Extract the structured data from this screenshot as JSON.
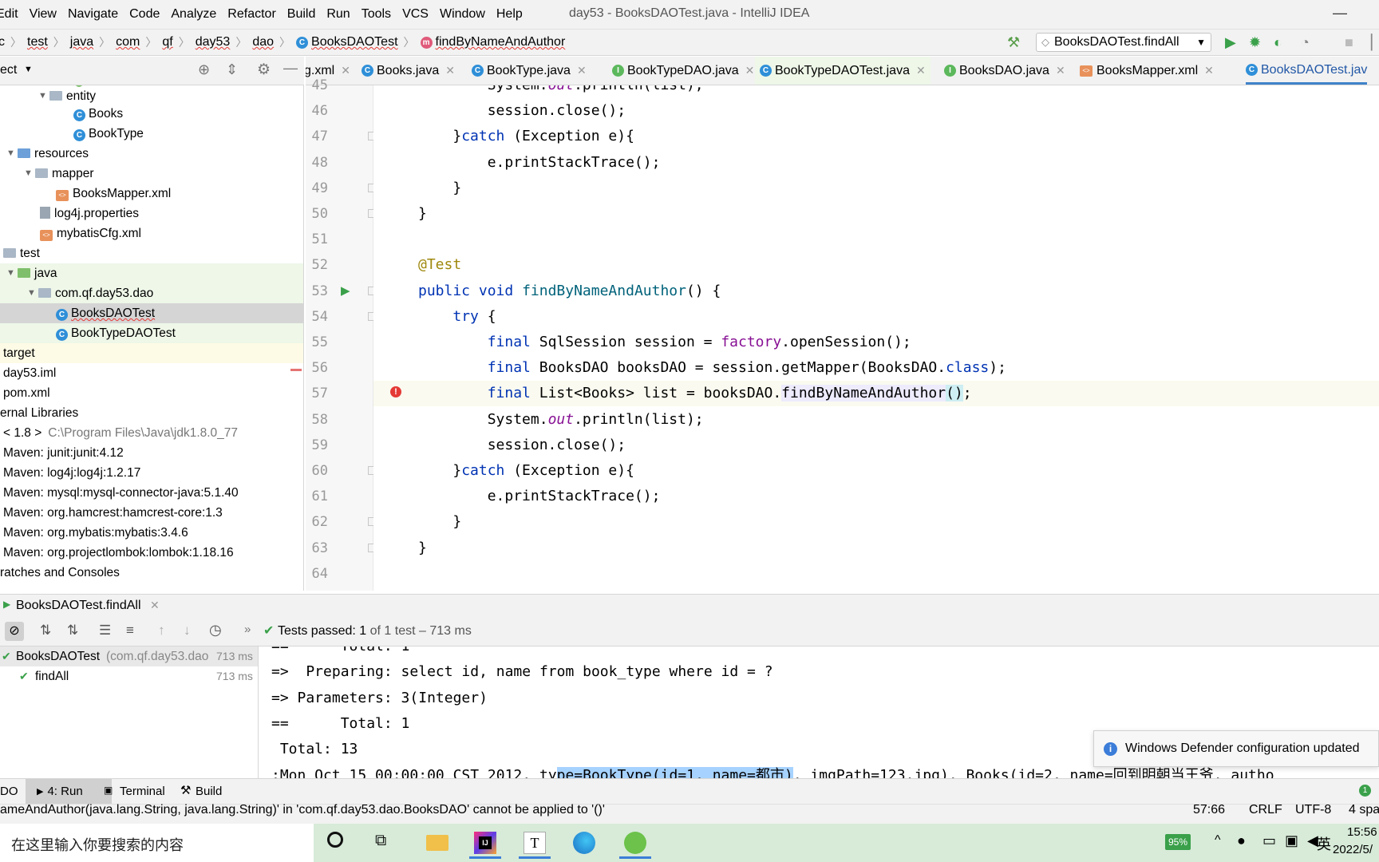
{
  "menu": {
    "items": [
      "Edit",
      "View",
      "Navigate",
      "Code",
      "Analyze",
      "Refactor",
      "Build",
      "Run",
      "Tools",
      "VCS",
      "Window",
      "Help"
    ],
    "window_title": "day53 - BooksDAOTest.java - IntelliJ IDEA",
    "minimize": "—"
  },
  "nav": {
    "crumbs": [
      "c",
      "test",
      "java",
      "com",
      "qf",
      "day53",
      "dao",
      "BooksDAOTest",
      "findByNameAndAuthor"
    ],
    "run_config": "BooksDAOTest.findAll"
  },
  "project": {
    "header": "ect",
    "rows": [
      {
        "label": "entity",
        "indent": 62,
        "type": "pkg",
        "arrow": true
      },
      {
        "label": "Books",
        "indent": 92,
        "type": "class"
      },
      {
        "label": "BookType",
        "indent": 92,
        "type": "class"
      },
      {
        "label": "resources",
        "indent": 22,
        "type": "res",
        "arrow": true
      },
      {
        "label": "mapper",
        "indent": 44,
        "type": "folder",
        "arrow": true
      },
      {
        "label": "BooksMapper.xml",
        "indent": 70,
        "type": "xml"
      },
      {
        "label": "log4j.properties",
        "indent": 50,
        "type": "props"
      },
      {
        "label": "mybatisCfg.xml",
        "indent": 50,
        "type": "xml"
      },
      {
        "label": "test",
        "indent": 4,
        "type": "folder"
      },
      {
        "label": "java",
        "indent": 22,
        "type": "green",
        "arrow": true
      },
      {
        "label": "com.qf.day53.dao",
        "indent": 48,
        "type": "pkg",
        "arrow": true
      },
      {
        "label": "BooksDAOTest",
        "indent": 70,
        "type": "class",
        "selected": true
      },
      {
        "label": "BookTypeDAOTest",
        "indent": 70,
        "type": "class"
      },
      {
        "label": "target",
        "indent": 4,
        "type": "plain"
      },
      {
        "label": "day53.iml",
        "indent": 4,
        "type": "plain"
      },
      {
        "label": "pom.xml",
        "indent": 4,
        "type": "plain"
      },
      {
        "label": "ernal Libraries",
        "indent": 0,
        "type": "plain"
      },
      {
        "label": "< 1.8 >",
        "indent": 4,
        "type": "plain",
        "suffix": "C:\\Program Files\\Java\\jdk1.8.0_77"
      },
      {
        "label": "Maven: junit:junit:4.12",
        "indent": 4,
        "type": "plain"
      },
      {
        "label": "Maven: log4j:log4j:1.2.17",
        "indent": 4,
        "type": "plain"
      },
      {
        "label": "Maven: mysql:mysql-connector-java:5.1.40",
        "indent": 4,
        "type": "plain"
      },
      {
        "label": "Maven: org.hamcrest:hamcrest-core:1.3",
        "indent": 4,
        "type": "plain"
      },
      {
        "label": "Maven: org.mybatis:mybatis:3.4.6",
        "indent": 4,
        "type": "plain"
      },
      {
        "label": "Maven: org.projectlombok:lombok:1.18.16",
        "indent": 4,
        "type": "plain"
      },
      {
        "label": "ratches and Consoles",
        "indent": 0,
        "type": "plain"
      }
    ]
  },
  "tabs": [
    {
      "label": "g.xml",
      "icon": "xml"
    },
    {
      "label": "Books.java",
      "icon": "c"
    },
    {
      "label": "BookType.java",
      "icon": "c"
    },
    {
      "label": "BookTypeDAO.java",
      "icon": "i"
    },
    {
      "label": "BookTypeDAOTest.java",
      "icon": "c"
    },
    {
      "label": "BooksDAO.java",
      "icon": "i"
    },
    {
      "label": "BooksMapper.xml",
      "icon": "xml"
    },
    {
      "label": "BooksDAOTest.jav",
      "icon": "c",
      "active": true
    }
  ],
  "code": {
    "lines": [
      {
        "n": "45",
        "html": "        System.<span class=\"it\">out</span>.println(list);"
      },
      {
        "n": "46",
        "html": "        session.close();"
      },
      {
        "n": "47",
        "html": "    }<span class=\"kw\">catch</span> (Exception e){"
      },
      {
        "n": "48",
        "html": "        e.printStackTrace();"
      },
      {
        "n": "49",
        "html": "    }"
      },
      {
        "n": "50",
        "html": "}"
      },
      {
        "n": "51",
        "html": ""
      },
      {
        "n": "52",
        "html": "<span class=\"ann\">@Test</span>"
      },
      {
        "n": "53",
        "html": "<span class=\"kw\">public void</span> <span class=\"fn\">findByNameAndAuthor</span>() {"
      },
      {
        "n": "54",
        "html": "    <span class=\"kw\">try</span> {"
      },
      {
        "n": "55",
        "html": "        <span class=\"kw\">final</span> SqlSession session = <span class=\"fld\">factory</span>.openSession();"
      },
      {
        "n": "56",
        "html": "        <span class=\"kw\">final</span> BooksDAO booksDAO = session.getMapper(BooksDAO.<span class=\"kw\">class</span>);"
      },
      {
        "n": "57",
        "html": "        <span class=\"kw\">final</span> List&lt;Books&gt; list = booksDAO.<span class=\"hl\">findByNameAndAuthor</span><span class=\"caret\">()</span>;"
      },
      {
        "n": "58",
        "html": "        System.<span class=\"it\">out</span>.println(list);"
      },
      {
        "n": "59",
        "html": "        session.close();"
      },
      {
        "n": "60",
        "html": "    }<span class=\"kw\">catch</span> (Exception e){"
      },
      {
        "n": "61",
        "html": "        e.printStackTrace();"
      },
      {
        "n": "62",
        "html": "    }"
      },
      {
        "n": "63",
        "html": "}"
      },
      {
        "n": "64",
        "html": ""
      }
    ]
  },
  "run": {
    "tab_label": "BooksDAOTest.findAll",
    "status_prefix": "Tests passed:",
    "status_count": "1",
    "status_suffix": "of 1 test – 713 ms",
    "tree": [
      {
        "label": "BooksDAOTest",
        "sub": "(com.qf.day53.dao",
        "time": "713 ms"
      },
      {
        "label": "findAll",
        "sub": "",
        "time": "713 ms"
      }
    ],
    "console": [
      "==      Total: 1",
      "=>  Preparing: select id, name from book_type where id = ?",
      "=> Parameters: 3(Integer)",
      "==      Total: 1",
      " Total: 13",
      ":Mon Oct 15 00:00:00 CST 2012, type=BookType(id=1, name=都市), imgPath=123.jpg), Books(id=2, name=回到明朝当王爷, autho"
    ]
  },
  "toast": {
    "text": "Windows Defender configuration updated"
  },
  "toolstrip": {
    "items": [
      "DO",
      "4: Run",
      "Terminal",
      "Build"
    ]
  },
  "statusbar": {
    "message": "ameAndAuthor(java.lang.String, java.lang.String)' in 'com.qf.day53.dao.BooksDAO' cannot be applied to '()'",
    "position": "57:66",
    "line_sep": "CRLF",
    "encoding": "UTF-8",
    "indent": "4 spaces"
  },
  "taskbar": {
    "search_placeholder": "在这里输入你要搜索的内容",
    "battery": "95%",
    "ime": "英",
    "time": "15:56",
    "date": "2022/5/"
  }
}
